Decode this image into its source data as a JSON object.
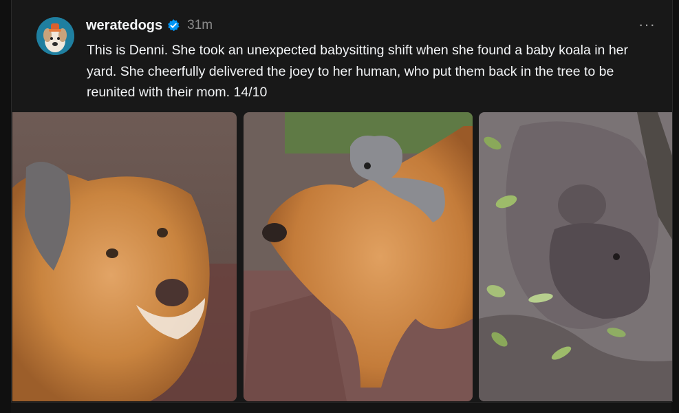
{
  "post": {
    "username": "weratedogs",
    "verified": true,
    "timestamp": "31m",
    "more_icon": "more-horizontal-icon",
    "caption": "This is Denni. She took an unexpected babysitting shift when she found a baby koala in her yard. She cheerfully delivered the joey to her human, who put them back in the tree to be reunited with their mom. 14/10",
    "more_label": "···"
  },
  "colors": {
    "background": "#101010",
    "card": "#181818",
    "text": "#f3f5f7",
    "muted": "#8a8a8a",
    "verified_badge": "#0095f6"
  }
}
